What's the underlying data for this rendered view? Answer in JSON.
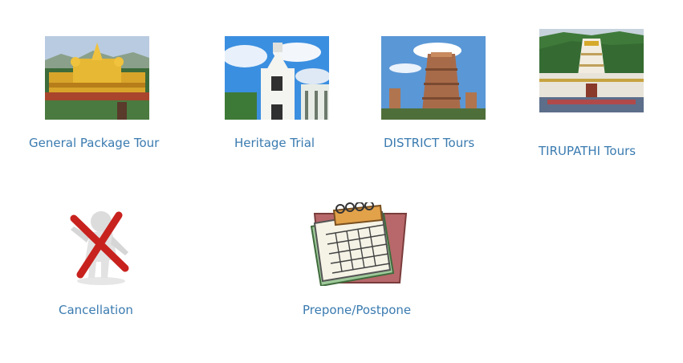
{
  "tours": [
    {
      "label": "General Package Tour",
      "image": "golden-temple-photo"
    },
    {
      "label": "Heritage Trial",
      "image": "church-tower-photo"
    },
    {
      "label": "DISTRICT Tours",
      "image": "gopuram-temple-photo"
    },
    {
      "label": "TIRUPATHI Tours",
      "image": "tirupati-temple-photo"
    }
  ],
  "actions": [
    {
      "label": "Cancellation",
      "image": "cancel-figure-icon"
    },
    {
      "label": "Prepone/Postpone",
      "image": "calendar-icon"
    }
  ]
}
